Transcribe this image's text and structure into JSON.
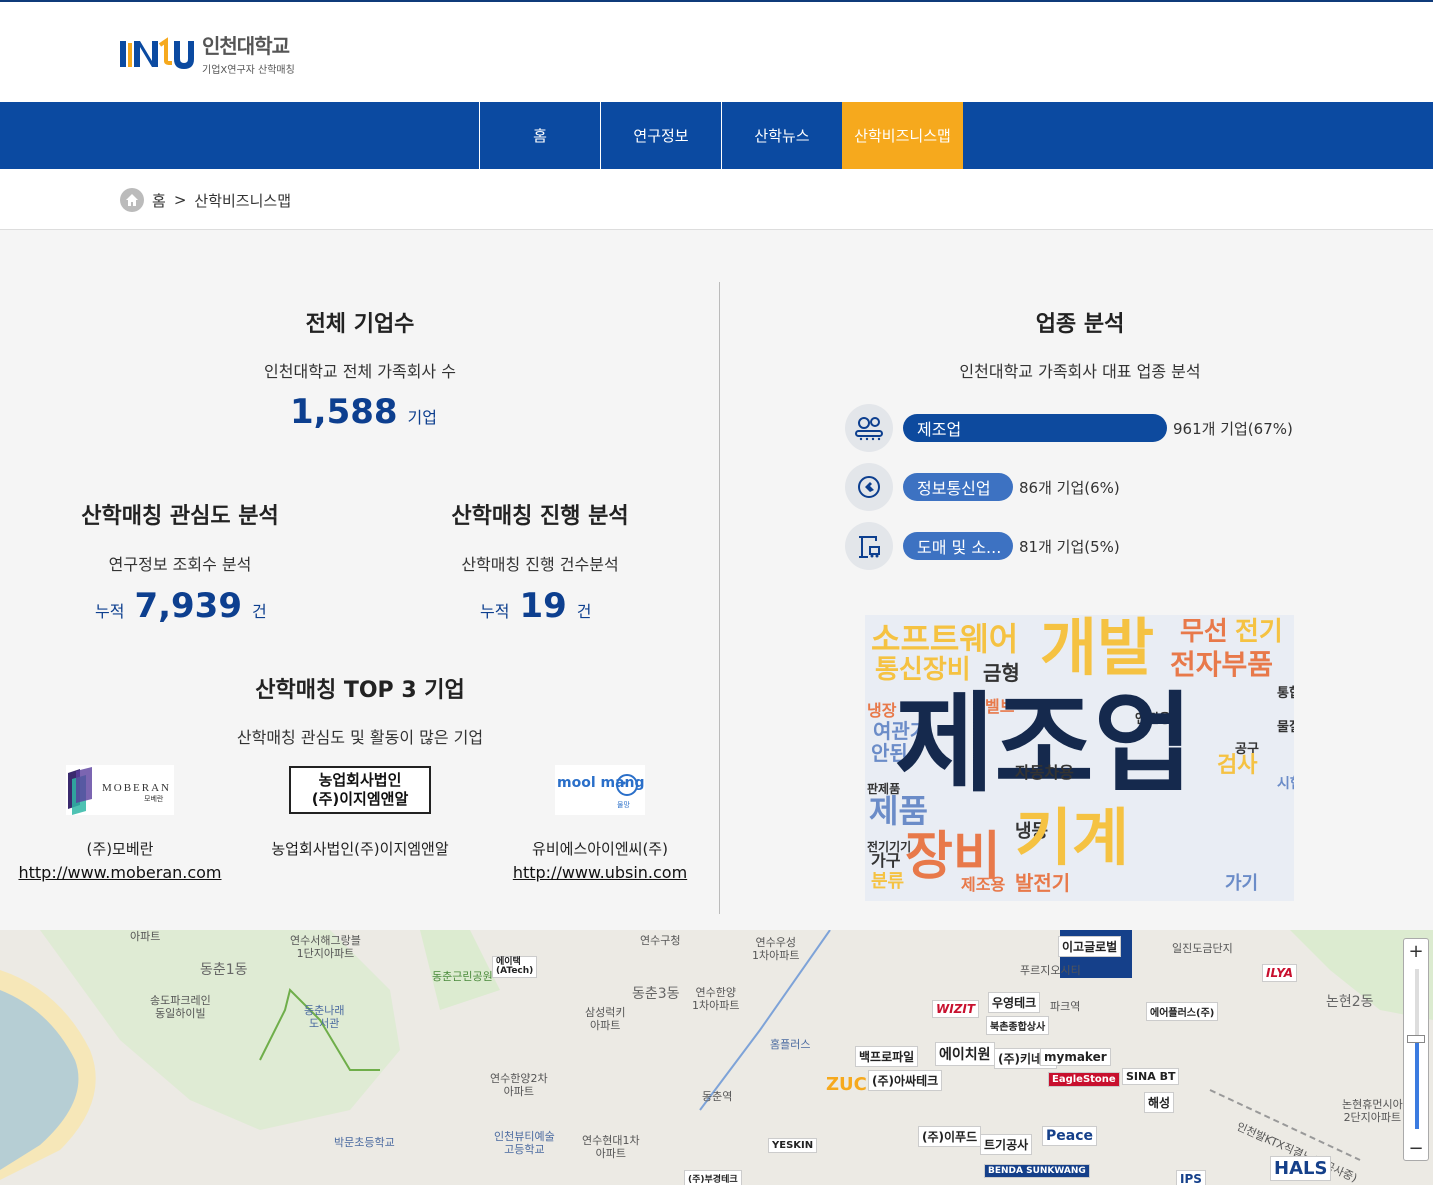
{
  "header": {
    "logo_name": "인천대학교",
    "logo_sub": "기업X연구자 산학매칭"
  },
  "nav": {
    "items": [
      {
        "label": "홈"
      },
      {
        "label": "연구정보"
      },
      {
        "label": "산학뉴스"
      },
      {
        "label": "산학비즈니스맵"
      }
    ],
    "active_color": "#f6a91d",
    "bar_color": "#0b4aa1"
  },
  "breadcrumb": {
    "home": "홈",
    "separator": ">",
    "current": "산학비즈니스맵"
  },
  "total": {
    "title": "전체 기업수",
    "subtitle": "인천대학교 전체 가족회사 수",
    "value": "1,588",
    "unit": "기업"
  },
  "interest": {
    "title": "산학매칭 관심도 분석",
    "subtitle": "연구정보 조회수 분석",
    "prefix": "누적",
    "value": "7,939",
    "unit": "건"
  },
  "progress": {
    "title": "산학매칭 진행 분석",
    "subtitle": "산학매칭 진행 건수분석",
    "prefix": "누적",
    "value": "19",
    "unit": "건"
  },
  "top3": {
    "title": "산학매칭 TOP 3 기업",
    "subtitle": "산학매칭 관심도 및 활동이 많은 기업",
    "companies": [
      {
        "logo_text": "MOBERAN",
        "logo_sub": "모베란",
        "name": "(주)모베란",
        "url": "http://www.moberan.com"
      },
      {
        "logo_text": "농업회사법인\n(주)이지엠앤알",
        "name": "농업회사법인(주)이지엠앤알",
        "url": ""
      },
      {
        "logo_text": "mool mang",
        "logo_sub": "물망",
        "name": "유비에스아이엔씨(주)",
        "url": "http://www.ubsin.com"
      }
    ]
  },
  "industry": {
    "title": "업종 분석",
    "subtitle": "인천대학교 가족회사 대표 업종 분석",
    "items": [
      {
        "label": "제조업",
        "value_text": "961개 기업(67%)",
        "share": 0.67,
        "icon": "factory-gear-icon",
        "color": "#0d4a9e"
      },
      {
        "label": "정보통신업",
        "value_text": "86개 기업(6%)",
        "share": 0.06,
        "icon": "plug-icon",
        "color": "#3d72c2"
      },
      {
        "label": "도매 및 소...",
        "value_text": "81개 기업(5%)",
        "share": 0.05,
        "icon": "crane-icon",
        "color": "#3d72c2"
      }
    ]
  },
  "wordcloud": {
    "words": [
      {
        "text": "제조업",
        "color": "#15294d"
      },
      {
        "text": "개발",
        "color": "#f5c242"
      },
      {
        "text": "기계",
        "color": "#f5c242"
      },
      {
        "text": "장비",
        "color": "#e8794a"
      },
      {
        "text": "소프트웨어",
        "color": "#f5c242"
      },
      {
        "text": "통신장비",
        "color": "#f5c242"
      },
      {
        "text": "전자부품",
        "color": "#e8794a"
      },
      {
        "text": "무선",
        "color": "#e8794a"
      },
      {
        "text": "전기",
        "color": "#f5c242"
      },
      {
        "text": "제품",
        "color": "#6b8cc8"
      },
      {
        "text": "금형",
        "color": "#333"
      },
      {
        "text": "발전기",
        "color": "#e8794a"
      },
      {
        "text": "자동차용",
        "color": "#333"
      },
      {
        "text": "가기",
        "color": "#6b8cc8"
      },
      {
        "text": "냉동",
        "color": "#333"
      },
      {
        "text": "검사",
        "color": "#f5c242"
      },
      {
        "text": "안된",
        "color": "#6b8cc8"
      },
      {
        "text": "가구",
        "color": "#333"
      },
      {
        "text": "여관기",
        "color": "#6b8cc8"
      },
      {
        "text": "분류",
        "color": "#f5c242"
      },
      {
        "text": "제조용",
        "color": "#e8794a"
      },
      {
        "text": "시험",
        "color": "#6b8cc8"
      },
      {
        "text": "엔진용",
        "color": "#333"
      },
      {
        "text": "전기기기",
        "color": "#333"
      },
      {
        "text": "통합",
        "color": "#333"
      },
      {
        "text": "물질",
        "color": "#333"
      },
      {
        "text": "공구",
        "color": "#333"
      },
      {
        "text": "냉장",
        "color": "#e8794a"
      },
      {
        "text": "벨브",
        "color": "#e8794a"
      },
      {
        "text": "판제품",
        "color": "#333"
      }
    ]
  },
  "map": {
    "labels": [
      {
        "text": "아파트"
      },
      {
        "text": "연수서해그랑블\n1단지아파트"
      },
      {
        "text": "연수구청"
      },
      {
        "text": "연수우성\n1차아파트"
      },
      {
        "text": "동춘1동"
      },
      {
        "text": "동춘근린공원"
      },
      {
        "text": "송도파크레인\n동일하이빌"
      },
      {
        "text": "동춘나래\n도서관"
      },
      {
        "text": "삼성럭키\n아파트"
      },
      {
        "text": "동춘3동"
      },
      {
        "text": "연수한양\n1차아파트"
      },
      {
        "text": "홈플러스"
      },
      {
        "text": "연수한양2차\n아파트"
      },
      {
        "text": "동춘역"
      },
      {
        "text": "박문초등학교"
      },
      {
        "text": "인천뷰티예술\n고등학교"
      },
      {
        "text": "연수현대1차\n아파트"
      },
      {
        "text": "일진도금단지"
      },
      {
        "text": "논현2동"
      },
      {
        "text": "논현휴먼시아\n2단지아파트"
      },
      {
        "text": "푸르지오시티"
      },
      {
        "text": "파크역"
      },
      {
        "text": "인천발KTX직결노선(공사중)"
      }
    ],
    "companies": [
      {
        "text": "에이택\n(ATech)"
      },
      {
        "text": "이고글로벌"
      },
      {
        "text": "WIZIT"
      },
      {
        "text": "우영테크"
      },
      {
        "text": "북촌종합상사"
      },
      {
        "text": "에어플러스(주)"
      },
      {
        "text": "ILYA"
      },
      {
        "text": "백프로파일"
      },
      {
        "text": "에이치원"
      },
      {
        "text": "(주)키네모"
      },
      {
        "text": "mymaker"
      },
      {
        "text": "EagleStone"
      },
      {
        "text": "SINA BT"
      },
      {
        "text": "ZUC"
      },
      {
        "text": "(주)아싸테크"
      },
      {
        "text": "해성"
      },
      {
        "text": "Peace"
      },
      {
        "text": "(주)이푸드"
      },
      {
        "text": "트기공사"
      },
      {
        "text": "YESKIN"
      },
      {
        "text": "HALS"
      },
      {
        "text": "BENDA SUNKWANG"
      },
      {
        "text": "IPS"
      },
      {
        "text": "(주)부경테크"
      }
    ],
    "zoom_level": 0.55
  }
}
